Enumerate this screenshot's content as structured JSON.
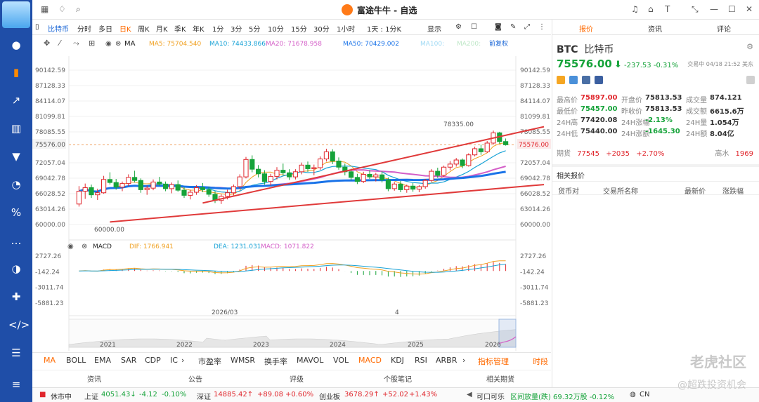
{
  "window": {
    "title": "富途牛牛 - 自选"
  },
  "colors": {
    "up": "#e0262c",
    "down": "#16a33a",
    "accent": "#ff6a00",
    "sidebar": "#1f4ea8",
    "ma5": "#f0a020",
    "ma10": "#17a2d6",
    "ma20": "#d45fc8",
    "ma50": "#1a73e8",
    "channel": "#e03a3a"
  },
  "sidebar_icons": [
    "user-icon",
    "chart-bar-icon",
    "trend-icon",
    "candlestick-icon",
    "filter-icon",
    "pie-icon",
    "percent-icon",
    "chat-icon",
    "moon-icon",
    "game-icon",
    "code-icon",
    "list-icon",
    "menu-icon"
  ],
  "toolbar": {
    "symbol": "比特币",
    "periods": [
      "分时",
      "多日",
      "日K",
      "周K",
      "月K",
      "季K",
      "年K",
      "1分",
      "3分",
      "5分",
      "10分",
      "15分",
      "30分",
      "1小时",
      "1天 : 1分K"
    ],
    "active_period": "日K",
    "display_label": "显示"
  },
  "ma_legend": {
    "ma_label": "MA",
    "ma5": "MA5:  75704.540",
    "ma10": "MA10:  74433.866",
    "ma20": "MA20:  71678.958",
    "ma50": "MA50:  70429.002",
    "ma100": "MA100:",
    "ma200": "MA200:",
    "adjust": "前复权"
  },
  "price_axis": [
    "90142.59",
    "87128.33",
    "84114.07",
    "81099.81",
    "78085.55",
    "75576.00",
    "72057.04",
    "69042.78",
    "66028.52",
    "63014.26",
    "60000.00"
  ],
  "price_annotations": {
    "high": "78335.00",
    "low": "60000.00",
    "current": "75576.00"
  },
  "macd_legend": {
    "label": "MACD",
    "dif": "DIF:  1766.941",
    "dea": "DEA:  1231.031",
    "macd": "MACD:  1071.822"
  },
  "macd_axis": [
    "2727.26",
    "-142.24",
    "-3011.74",
    "-5881.23"
  ],
  "date_labels": [
    "2026/03",
    "4"
  ],
  "overview_years": [
    "2021",
    "2022",
    "2023",
    "2024",
    "2025",
    "2026"
  ],
  "indicators": [
    "MA",
    "BOLL",
    "EMA",
    "SAR",
    "CDP",
    "IC",
    "市盈率",
    "WMSR",
    "换手率",
    "MAVOL",
    "VOL",
    "MACD",
    "KDJ",
    "RSI",
    "ARBR",
    "指标管理",
    "时段"
  ],
  "bottom_tabs": [
    "资讯",
    "公告",
    "评级",
    "个股笔记",
    "相关期货"
  ],
  "status": {
    "market": "休市中",
    "idx1_name": "上证",
    "idx1_val": "4051.43↓",
    "idx1_chg": "-4.12",
    "idx1_pct": "-0.10%",
    "idx2_name": "深证",
    "idx2_val": "14885.42↑",
    "idx2_chg": "+89.08",
    "idx2_pct": "+0.60%",
    "idx3_name": "创业板",
    "idx3_val": "3678.29↑",
    "idx3_chg": "+52.02",
    "idx3_pct": "+1.43%",
    "connect": "可口可乐",
    "volume": "区间放量(跌) 69.32万股 -0.12%",
    "region": "CN"
  },
  "right_panel": {
    "tabs": [
      "报价",
      "资讯",
      "评论"
    ],
    "code": "BTC",
    "name": "比特币",
    "price": "75576.00",
    "change": "-237.53",
    "change_pct": "-0.31%",
    "trade_time": "交易中 04/18 21:52 美东",
    "stats": [
      [
        "最高价",
        "75897.00",
        "开盘价",
        "75813.53",
        "成交量",
        "874.121"
      ],
      [
        "最低价",
        "75457.00",
        "昨收价",
        "75813.53",
        "成交额",
        "6615.6万"
      ],
      [
        "24H高",
        "77420.08",
        "24H涨幅",
        "-2.13%",
        "24H量",
        "1.054万"
      ],
      [
        "24H低",
        "75440.00",
        "24H涨额",
        "-1645.30",
        "24H额",
        "8.04亿"
      ]
    ],
    "futures": {
      "label": "期货",
      "price": "77545",
      "change": "+2035",
      "pct": "+2.70%",
      "premium_label": "高水",
      "premium": "1969"
    },
    "related_title": "相关报价",
    "related_headers": [
      "货币对",
      "交易所名称",
      "最新价",
      "涨跌幅"
    ]
  },
  "watermark": {
    "main": "老虎社区",
    "sub": "@超跌投资机会"
  },
  "chart_data": {
    "type": "candlestick",
    "y_range": [
      60000,
      90142.59
    ],
    "candles": [
      [
        64000,
        67500,
        63500,
        66500
      ],
      [
        66500,
        68000,
        65000,
        67200
      ],
      [
        67200,
        67800,
        65200,
        65800
      ],
      [
        65800,
        67000,
        64800,
        66200
      ],
      [
        66200,
        69500,
        66000,
        68800
      ],
      [
        68800,
        70200,
        67800,
        68200
      ],
      [
        68200,
        68900,
        66800,
        67300
      ],
      [
        67300,
        68400,
        66500,
        68000
      ],
      [
        68000,
        69800,
        67500,
        69200
      ],
      [
        69200,
        70500,
        68200,
        68600
      ],
      [
        68600,
        69000,
        66200,
        66800
      ],
      [
        66800,
        67600,
        65800,
        67100
      ],
      [
        67100,
        68800,
        66700,
        68300
      ],
      [
        68300,
        69300,
        67600,
        67900
      ],
      [
        67900,
        68400,
        66500,
        67000
      ],
      [
        67000,
        68200,
        66100,
        67800
      ],
      [
        67800,
        68600,
        66400,
        66700
      ],
      [
        66700,
        67300,
        65200,
        65700
      ],
      [
        65700,
        66800,
        64900,
        66300
      ],
      [
        66300,
        67700,
        65800,
        67200
      ],
      [
        67200,
        68100,
        66300,
        66800
      ],
      [
        66800,
        67400,
        65400,
        65900
      ],
      [
        65900,
        66500,
        64200,
        64700
      ],
      [
        64700,
        65900,
        64000,
        65500
      ],
      [
        65500,
        66800,
        64900,
        66200
      ],
      [
        66200,
        67800,
        65700,
        67400
      ],
      [
        67400,
        69800,
        67000,
        69300
      ],
      [
        69300,
        73200,
        69000,
        72700
      ],
      [
        72700,
        73500,
        70200,
        70800
      ],
      [
        70800,
        71600,
        69200,
        69900
      ],
      [
        69900,
        70600,
        67800,
        68400
      ],
      [
        68400,
        69900,
        67600,
        69400
      ],
      [
        69400,
        71200,
        68800,
        70600
      ],
      [
        70600,
        71900,
        69600,
        70100
      ],
      [
        70100,
        70800,
        68700,
        69300
      ],
      [
        69300,
        70800,
        68800,
        70300
      ],
      [
        70300,
        72100,
        69800,
        71600
      ],
      [
        71600,
        72300,
        70300,
        70900
      ],
      [
        70900,
        71700,
        69600,
        71100
      ],
      [
        71100,
        73300,
        70700,
        72800
      ],
      [
        72800,
        74800,
        72300,
        74200
      ],
      [
        74200,
        74700,
        71800,
        72400
      ],
      [
        72400,
        73100,
        70700,
        71200
      ],
      [
        71200,
        71900,
        69600,
        70300
      ],
      [
        70300,
        70900,
        68600,
        69200
      ],
      [
        69200,
        69900,
        67900,
        68400
      ],
      [
        68400,
        70300,
        68100,
        69800
      ],
      [
        69800,
        70600,
        68900,
        69300
      ],
      [
        69300,
        70100,
        68400,
        69700
      ],
      [
        69700,
        70400,
        68200,
        68700
      ],
      [
        68700,
        69200,
        66500,
        67000
      ],
      [
        67000,
        68300,
        66600,
        67900
      ],
      [
        67900,
        68500,
        66300,
        66800
      ],
      [
        66800,
        67800,
        66200,
        67500
      ],
      [
        67500,
        68100,
        66400,
        66900
      ],
      [
        66900,
        67700,
        66300,
        67400
      ],
      [
        67400,
        68900,
        67000,
        68600
      ],
      [
        68600,
        70800,
        68300,
        70400
      ],
      [
        70400,
        71100,
        69100,
        69600
      ],
      [
        69600,
        71500,
        69300,
        71200
      ],
      [
        71200,
        72400,
        70600,
        71800
      ],
      [
        71800,
        73000,
        71300,
        72600
      ],
      [
        72600,
        72900,
        71000,
        71500
      ],
      [
        71500,
        73900,
        71300,
        73600
      ],
      [
        73600,
        75200,
        73300,
        74800
      ],
      [
        74800,
        75600,
        73600,
        74200
      ],
      [
        74200,
        76300,
        74000,
        75900
      ],
      [
        75900,
        78335,
        75600,
        77900
      ],
      [
        77900,
        78100,
        75800,
        76200
      ],
      [
        76200,
        76800,
        75400,
        75576
      ]
    ],
    "macd_range": [
      -5881.23,
      2727.26
    ]
  }
}
